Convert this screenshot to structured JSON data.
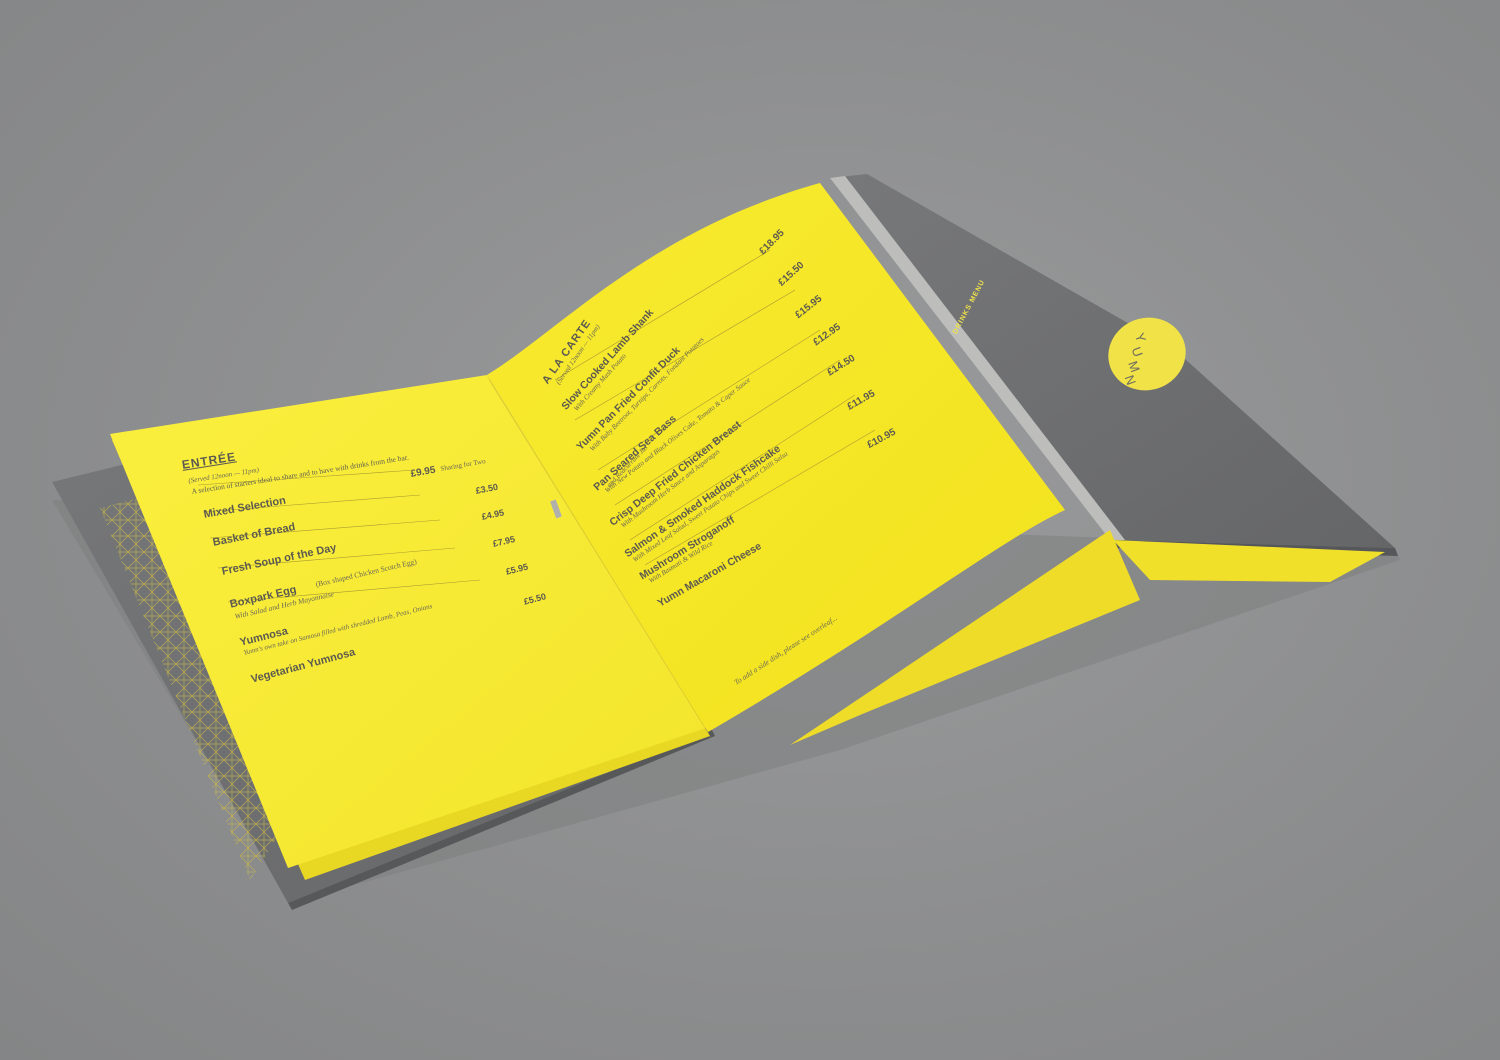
{
  "colors": {
    "background": "#8f9091",
    "cover_grey": "#6e6f71",
    "paper_yellow": "#f6e932",
    "ink": "#5c5a50"
  },
  "left_page": {
    "heading": "ENTRÉE",
    "served": "(Served 12noon — 11pm)",
    "intro": "A selection of starters ideal to share and to have with drinks from the bar.",
    "items": [
      {
        "name": "Mixed Selection",
        "price": "£9.95",
        "note": "Sharing for Two"
      },
      {
        "name": "Basket of Bread",
        "price": "£3.50"
      },
      {
        "name": "Fresh Soup of the Day",
        "price": "£4.95"
      },
      {
        "name": "Boxpark Egg",
        "note": "(Box shaped Chicken Scotch Egg)",
        "sub": "With Salad and Herb Mayonnaise",
        "price": "£7.95"
      },
      {
        "name": "Yumnosa",
        "sub": "Yumn's own take on Samosa filled with shredded Lamb, Peas, Onions",
        "price": "£5.95"
      },
      {
        "name": "Vegetarian Yumnosa",
        "price": "£5.50"
      }
    ]
  },
  "right_page": {
    "heading": "A LA CARTE",
    "served": "(Served 12noon — 11pm)",
    "items": [
      {
        "name": "Slow Cooked Lamb Shank",
        "sub": "With Creamy Mash Potato",
        "price": "£18.95"
      },
      {
        "name": "Yumn Pan Fried Confit Duck",
        "sub": "With Baby Beetroot, Turnips, Carrots, Fondant Potatoes",
        "price": "£15.50"
      },
      {
        "name": "Pan Seared Sea Bass",
        "sub": "With New Potato and Black Olives Cake, Tomato & Caper Sauce",
        "sub2": "and Redcurrant Jus",
        "price": "£15.95"
      },
      {
        "name": "Crisp Deep Fried Chicken Breast",
        "sub": "With Mushroom Herb Sauce and Asparagus",
        "price": "£12.95"
      },
      {
        "name": "Salmon & Smoked Haddock Fishcake",
        "sub": "With Mixed Leaf Salad, Sweet Potato Chips and Sweet Chilli Salsa",
        "price": "£14.50"
      },
      {
        "name": "Mushroom Stroganoff",
        "sub": "With Basmati & Wild Rice",
        "price": "£11.95"
      },
      {
        "name": "Yumn Macaroni Cheese",
        "price": "£10.95"
      }
    ],
    "footer": "To add a side dish, please see overleaf..."
  },
  "cover": {
    "spine_label": "DRINKS MENU",
    "logo_letters": [
      "Y",
      "U",
      "M",
      "N"
    ]
  }
}
